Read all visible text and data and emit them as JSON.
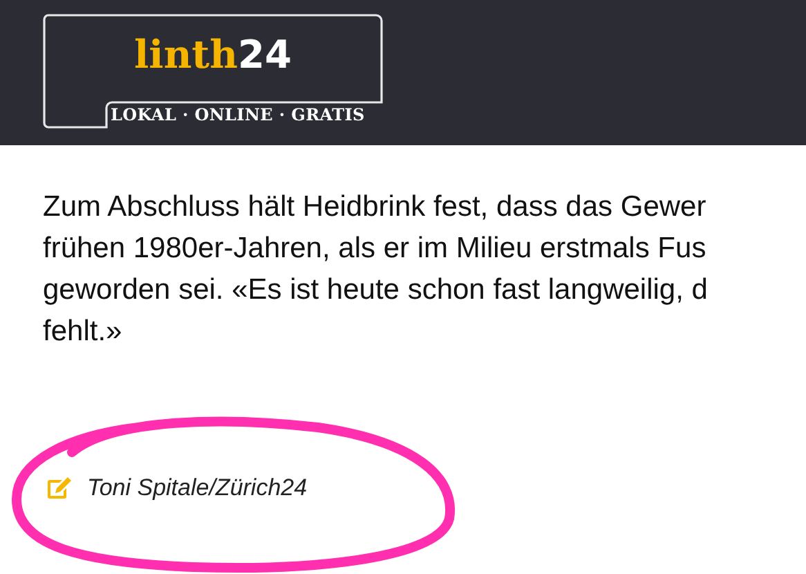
{
  "header": {
    "logo": {
      "name_part": "linth",
      "number_part": "24",
      "tagline": "LOKAL · ONLINE · GRATIS"
    }
  },
  "article": {
    "paragraph_lines": [
      "Zum Abschluss hält Heidbrink fest, dass das Gewer",
      "frühen 1980er-Jahren, als er im Milieu erstmals Fus",
      "geworden sei. «Es ist heute schon fast langweilig, d",
      "fehlt.»"
    ],
    "author": "Toni Spitale/Zürich24"
  }
}
